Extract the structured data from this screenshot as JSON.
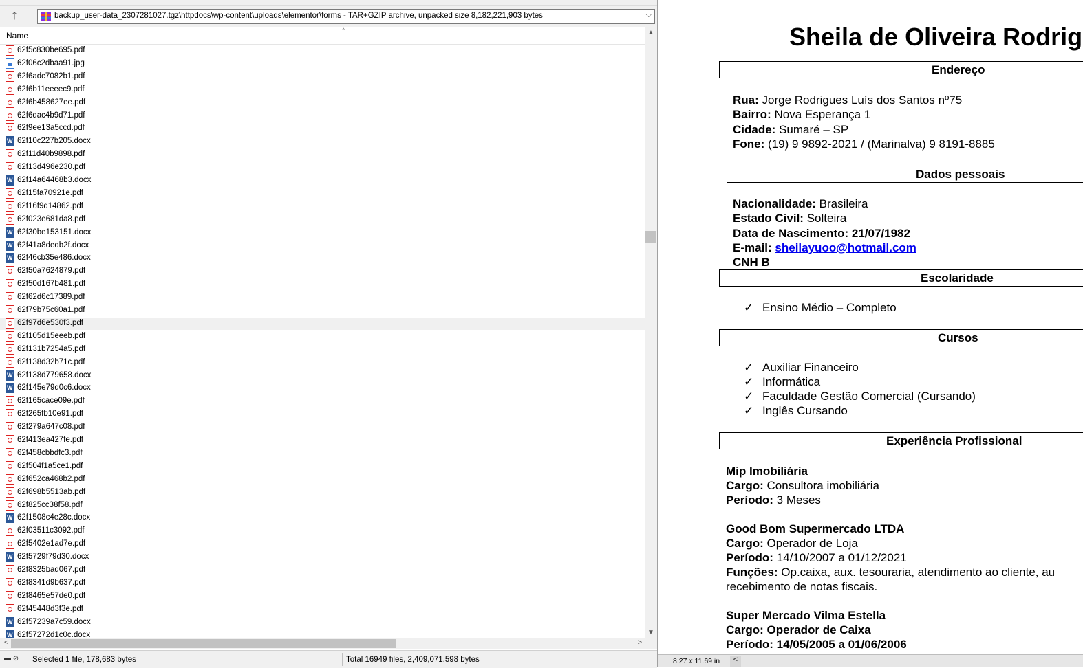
{
  "archive": {
    "path": "backup_user-data_2307281027.tgz\\httpdocs\\wp-content\\uploads\\elementor\\forms - TAR+GZIP archive, unpacked size 8,182,221,903 bytes",
    "column_name": "Name",
    "files": [
      {
        "name": "62f5c830be695.pdf",
        "type": "pdf"
      },
      {
        "name": "62f06c2dbaa91.jpg",
        "type": "jpg"
      },
      {
        "name": "62f6adc7082b1.pdf",
        "type": "pdf"
      },
      {
        "name": "62f6b11eeeec9.pdf",
        "type": "pdf"
      },
      {
        "name": "62f6b458627ee.pdf",
        "type": "pdf"
      },
      {
        "name": "62f6dac4b9d71.pdf",
        "type": "pdf"
      },
      {
        "name": "62f9ee13a5ccd.pdf",
        "type": "pdf"
      },
      {
        "name": "62f10c227b205.docx",
        "type": "docx"
      },
      {
        "name": "62f11d40b9898.pdf",
        "type": "pdf"
      },
      {
        "name": "62f13d496e230.pdf",
        "type": "pdf"
      },
      {
        "name": "62f14a64468b3.docx",
        "type": "docx"
      },
      {
        "name": "62f15fa70921e.pdf",
        "type": "pdf"
      },
      {
        "name": "62f16f9d14862.pdf",
        "type": "pdf"
      },
      {
        "name": "62f023e681da8.pdf",
        "type": "pdf"
      },
      {
        "name": "62f30be153151.docx",
        "type": "docx"
      },
      {
        "name": "62f41a8dedb2f.docx",
        "type": "docx"
      },
      {
        "name": "62f46cb35e486.docx",
        "type": "docx"
      },
      {
        "name": "62f50a7624879.pdf",
        "type": "pdf"
      },
      {
        "name": "62f50d167b481.pdf",
        "type": "pdf"
      },
      {
        "name": "62f62d6c17389.pdf",
        "type": "pdf"
      },
      {
        "name": "62f79b75c60a1.pdf",
        "type": "pdf"
      },
      {
        "name": "62f97d6e530f3.pdf",
        "type": "pdf",
        "selected": true
      },
      {
        "name": "62f105d15eeeb.pdf",
        "type": "pdf"
      },
      {
        "name": "62f131b7254a5.pdf",
        "type": "pdf"
      },
      {
        "name": "62f138d32b71c.pdf",
        "type": "pdf"
      },
      {
        "name": "62f138d779658.docx",
        "type": "docx"
      },
      {
        "name": "62f145e79d0c6.docx",
        "type": "docx"
      },
      {
        "name": "62f165cace09e.pdf",
        "type": "pdf"
      },
      {
        "name": "62f265fb10e91.pdf",
        "type": "pdf"
      },
      {
        "name": "62f279a647c08.pdf",
        "type": "pdf"
      },
      {
        "name": "62f413ea427fe.pdf",
        "type": "pdf"
      },
      {
        "name": "62f458cbbdfc3.pdf",
        "type": "pdf"
      },
      {
        "name": "62f504f1a5ce1.pdf",
        "type": "pdf"
      },
      {
        "name": "62f652ca468b2.pdf",
        "type": "pdf"
      },
      {
        "name": "62f698b5513ab.pdf",
        "type": "pdf"
      },
      {
        "name": "62f825cc38f58.pdf",
        "type": "pdf"
      },
      {
        "name": "62f1508c4e28c.docx",
        "type": "docx"
      },
      {
        "name": "62f03511c3092.pdf",
        "type": "pdf"
      },
      {
        "name": "62f5402e1ad7e.pdf",
        "type": "pdf"
      },
      {
        "name": "62f5729f79d30.docx",
        "type": "docx"
      },
      {
        "name": "62f8325bad067.pdf",
        "type": "pdf"
      },
      {
        "name": "62f8341d9b637.pdf",
        "type": "pdf"
      },
      {
        "name": "62f8465e57de0.pdf",
        "type": "pdf"
      },
      {
        "name": "62f45448d3f3e.pdf",
        "type": "pdf"
      },
      {
        "name": "62f57239a7c59.docx",
        "type": "docx"
      },
      {
        "name": "62f57272d1c0c.docx",
        "type": "docx"
      }
    ],
    "status_selected": "Selected 1 file, 178,683 bytes",
    "status_total": "Total 16949 files, 2,409,071,598 bytes"
  },
  "resume": {
    "title": "Sheila de Oliveira Rodrig",
    "sec_endereco": "Endereço",
    "rua_label": "Rua:",
    "rua_value": " Jorge Rodrigues  Luís dos Santos nº75",
    "bairro_label": "Bairro:",
    "bairro_value": " Nova Esperança 1",
    "cidade_label": "Cidade:",
    "cidade_value": " Sumaré – SP",
    "fone_label": "Fone:",
    "fone_value": " (19) 9 9892-2021 / (Marinalva) 9 8191-8885",
    "sec_dados": "Dados pessoais",
    "nac_label": "Nacionalidade:",
    "nac_value": " Brasileira",
    "civil_label": "Estado Civil:",
    "civil_value": " Solteira",
    "nasc_label": "Data de Nascimento: 21/07/1982",
    "email_label": "E-mail: ",
    "email_value": "sheilayuoo@hotmail.com",
    "cnh": "CNH B",
    "sec_escolaridade": "Escolaridade",
    "escolaridade": [
      "Ensino Médio – Completo"
    ],
    "sec_cursos": "Cursos",
    "cursos": [
      "Auxiliar Financeiro",
      "Informática",
      "Faculdade Gestão Comercial (Cursando)",
      "Inglês Cursando"
    ],
    "sec_experiencia": "Experiência Profissional",
    "job1_company": "Mip Imobiliária",
    "job1_cargo_label": "Cargo:",
    "job1_cargo": " Consultora imobiliária",
    "job1_periodo_label": "Período:",
    "job1_periodo": " 3 Meses",
    "job2_company": "Good Bom Supermercado LTDA",
    "job2_cargo_label": "Cargo:",
    "job2_cargo": " Operador de Loja",
    "job2_periodo_label": "Período:",
    "job2_periodo": " 14/10/2007 a 01/12/2021",
    "job2_funcoes_label": "Funções:",
    "job2_funcoes": " Op.caixa, aux. tesouraria, atendimento ao cliente, au",
    "job2_funcoes_cont": "recebimento de notas fiscais.",
    "job3_company": "Super Mercado Vilma Estella",
    "job3_cargo": "Cargo: Operador de Caixa",
    "job3_periodo": "Período: 14/05/2005 a 01/06/2006"
  },
  "viewer": {
    "page_size": "8.27 x 11.69 in"
  }
}
